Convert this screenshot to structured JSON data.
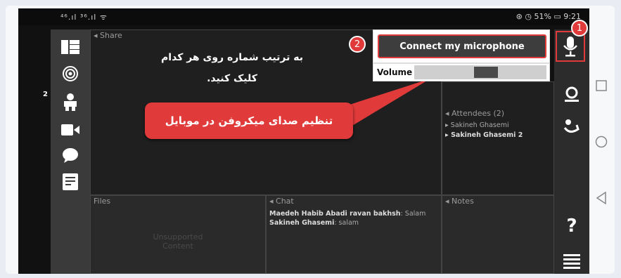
{
  "status": {
    "left": "⁴⁶.ıl ³⁶.ıl ᯤ",
    "right": "⊛ ◷ 51% ▭ 9:21"
  },
  "pods": {
    "share": "Share",
    "attendees": "Attendees (2)",
    "files": "Files",
    "chat": "Chat",
    "notes": "Notes",
    "attendee_list": [
      "Sakineh Ghasemi",
      "Sakineh Ghasemi 2"
    ],
    "unsupported": [
      "Unsupported",
      "Content"
    ]
  },
  "chat": [
    {
      "name": "Maedeh Habib Abadi ravan bakhsh",
      "text": ": Salam"
    },
    {
      "name": "Sakineh Ghasemi",
      "text": ": salam"
    }
  ],
  "instructions": {
    "line1": "به ترتیب شماره روی هر کدام",
    "line2": "کلیک کنید."
  },
  "callout": "تنظیم صدای میکروفن در موبایل",
  "audio": {
    "connect_label": "Connect my microphone",
    "volume_label": "Volume",
    "volume_level": 0.55
  },
  "badges": {
    "one": "1",
    "two": "2"
  },
  "left_count": "2",
  "rightbar": {
    "help": "?"
  },
  "colors": {
    "accent": "#e13a3a",
    "dark_bg": "#2a2a2a"
  },
  "icons": {
    "left": [
      "layout-icon",
      "target-icon",
      "attendee-icon",
      "camera-icon",
      "chat-bubble-icon",
      "notes-icon"
    ],
    "right": [
      "microphone-icon",
      "user-icon",
      "raise-hand-icon",
      "help-icon",
      "menu-icon"
    ]
  }
}
